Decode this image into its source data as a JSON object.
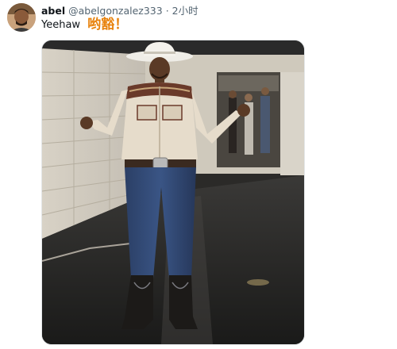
{
  "tweet": {
    "display_name": "abel",
    "handle": "@abelgonzalez333",
    "separator": "·",
    "time": "2小时",
    "text": "Yeehaw",
    "overlay_text": "哟豁！"
  },
  "icons": {
    "avatar": "user-avatar",
    "media": "photo"
  },
  "colors": {
    "overlay_text": "#e8820c",
    "handle": "#536471",
    "text": "#0f1419"
  }
}
